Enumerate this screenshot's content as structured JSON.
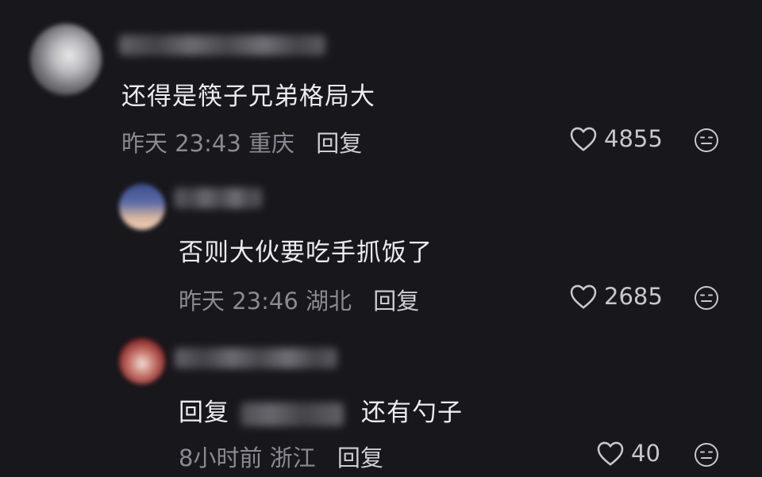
{
  "comments": [
    {
      "text": "还得是筷子兄弟格局大",
      "time": "昨天 23:43",
      "location": "重庆",
      "reply_label": "回复",
      "likes": "4855"
    },
    {
      "text": "否则大伙要吃手抓饭了",
      "time": "昨天 23:46",
      "location": "湖北",
      "reply_label": "回复",
      "likes": "2685"
    },
    {
      "reply_prefix": "回复",
      "text": "还有勺子",
      "time": "8小时前",
      "location": "浙江",
      "reply_label": "回复",
      "likes": "40"
    }
  ],
  "icons": {
    "like": "heart-outline-icon",
    "dislike": "meh-face-icon"
  },
  "colors": {
    "background": "#18171c",
    "text": "#ececee",
    "meta": "#8b8a92"
  }
}
